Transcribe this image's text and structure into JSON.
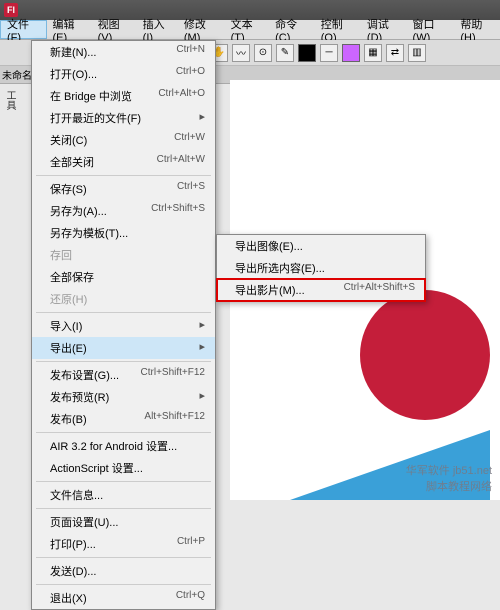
{
  "app": {
    "icon_letter": "Fl"
  },
  "menu_bar": [
    "文件(F)",
    "编辑(E)",
    "视图(V)",
    "插入(I)",
    "修改(M)",
    "文本(T)",
    "命令(C)",
    "控制(O)",
    "调试(D)",
    "窗口(W)",
    "帮助(H)"
  ],
  "toolbar": {
    "swatch_stroke": "#000000",
    "swatch_fill": "#cc66ff"
  },
  "doc_tab": "未命名",
  "side_label": "工具",
  "file_menu": [
    {
      "label": "新建(N)...",
      "shortcut": "Ctrl+N"
    },
    {
      "label": "打开(O)...",
      "shortcut": "Ctrl+O"
    },
    {
      "label": "在 Bridge 中浏览",
      "shortcut": "Ctrl+Alt+O"
    },
    {
      "label": "打开最近的文件(F)",
      "sub": true
    },
    {
      "label": "关闭(C)",
      "shortcut": "Ctrl+W"
    },
    {
      "label": "全部关闭",
      "shortcut": "Ctrl+Alt+W"
    },
    {
      "sep": true
    },
    {
      "label": "保存(S)",
      "shortcut": "Ctrl+S"
    },
    {
      "label": "另存为(A)...",
      "shortcut": "Ctrl+Shift+S"
    },
    {
      "label": "另存为模板(T)..."
    },
    {
      "label": "存回",
      "disabled": true
    },
    {
      "label": "全部保存"
    },
    {
      "label": "还原(H)",
      "disabled": true
    },
    {
      "sep": true
    },
    {
      "label": "导入(I)",
      "sub": true
    },
    {
      "label": "导出(E)",
      "sub": true,
      "highlight": true
    },
    {
      "sep": true
    },
    {
      "label": "发布设置(G)...",
      "shortcut": "Ctrl+Shift+F12"
    },
    {
      "label": "发布预览(R)",
      "sub": true
    },
    {
      "label": "发布(B)",
      "shortcut": "Alt+Shift+F12"
    },
    {
      "sep": true
    },
    {
      "label": "AIR 3.2 for Android 设置..."
    },
    {
      "label": "ActionScript 设置..."
    },
    {
      "sep": true
    },
    {
      "label": "文件信息..."
    },
    {
      "sep": true
    },
    {
      "label": "页面设置(U)..."
    },
    {
      "label": "打印(P)...",
      "shortcut": "Ctrl+P"
    },
    {
      "sep": true
    },
    {
      "label": "发送(D)..."
    },
    {
      "sep": true
    },
    {
      "label": "退出(X)",
      "shortcut": "Ctrl+Q"
    }
  ],
  "export_submenu": [
    {
      "label": "导出图像(E)..."
    },
    {
      "label": "导出所选内容(E)..."
    },
    {
      "label": "导出影片(M)...",
      "shortcut": "Ctrl+Alt+Shift+S",
      "boxed": true
    }
  ],
  "watermark": {
    "line1": "华军软件 jb51.net",
    "line2": "脚本教程网络"
  }
}
